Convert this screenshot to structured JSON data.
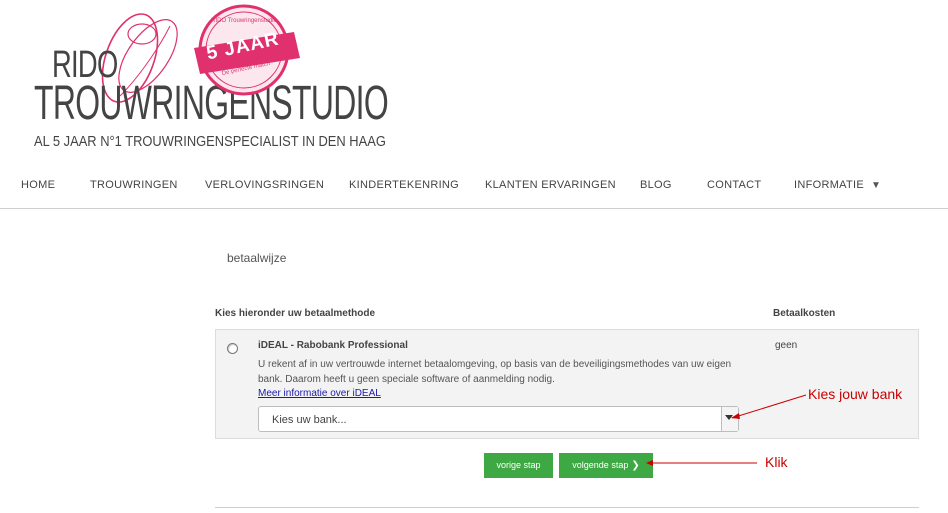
{
  "logo": {
    "line1": "RIDO",
    "line2": "TROUWRINGENSTUDIO",
    "tagline": "AL 5 JAAR N°1 TROUWRINGENSPECIALIST IN DEN HAAG",
    "badge_big": "5 JAAR",
    "badge_arc": "RIDO Trouwringenstudio",
    "badge_small": "De perfecte match",
    "accent_color": "#e0306e"
  },
  "nav": {
    "items": [
      {
        "label": "HOME"
      },
      {
        "label": "TROUWRINGEN"
      },
      {
        "label": "VERLOVINGSRINGEN"
      },
      {
        "label": "KINDERTEKENRING"
      },
      {
        "label": "KLANTEN ERVARINGEN"
      },
      {
        "label": "BLOG"
      },
      {
        "label": "CONTACT"
      },
      {
        "label": "INFORMATIE",
        "caret": "▼"
      }
    ]
  },
  "page": {
    "heading": "betaalwijze",
    "col_method": "Kies hieronder uw betaalmethode",
    "col_cost": "Betaalkosten"
  },
  "payment_method": {
    "title": "iDEAL - Rabobank Professional",
    "description": "U rekent af in uw vertrouwde internet betaalomgeving, op basis van de beveiligingsmethodes van uw eigen bank. Daarom heeft u geen speciale software of aanmelding nodig.",
    "link": "Meer informatie over iDEAL",
    "cost": "geen",
    "bank_select": {
      "value": "Kies uw bank..."
    }
  },
  "buttons": {
    "prev": "vorige stap",
    "next": "volgende stap",
    "next_chevron": "❯",
    "color": "#3ea845"
  },
  "annotations": {
    "bank": "Kies jouw bank",
    "click": "Klik",
    "color": "#cc0000"
  }
}
